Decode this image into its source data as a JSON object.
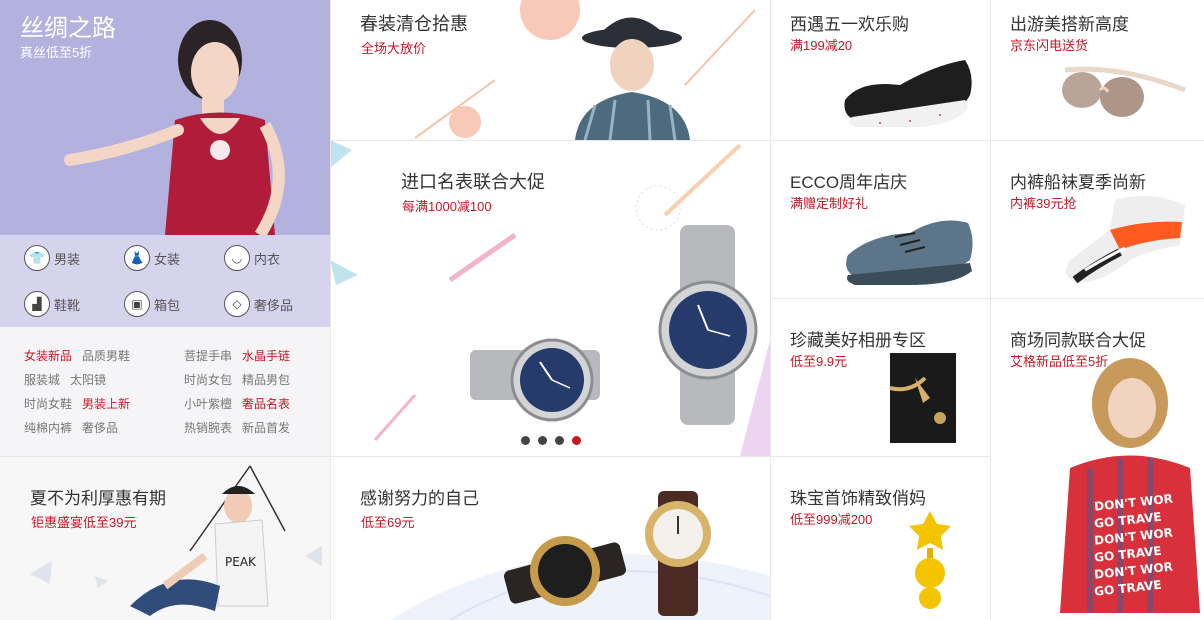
{
  "silk": {
    "title": "丝绸之路",
    "subtitle": "真丝低至5折",
    "categories": [
      {
        "label": "男装",
        "icon": "tshirt-icon",
        "glyph": "👕"
      },
      {
        "label": "女装",
        "icon": "dress-icon",
        "glyph": "👗"
      },
      {
        "label": "内衣",
        "icon": "bra-icon",
        "glyph": "◡"
      },
      {
        "label": "鞋靴",
        "icon": "boot-icon",
        "glyph": "▟"
      },
      {
        "label": "箱包",
        "icon": "bag-icon",
        "glyph": "▣"
      },
      {
        "label": "奢侈品",
        "icon": "diamond-icon",
        "glyph": "◇"
      }
    ],
    "keywords": [
      [
        "女装新品",
        "品质男鞋",
        "菩提手串",
        "水晶手链"
      ],
      [
        "服装城",
        "太阳镜",
        "时尚女包",
        "精品男包"
      ],
      [
        "时尚女鞋",
        "男装上新",
        "小叶紫檀",
        "奢品名表"
      ],
      [
        "纯棉内裤",
        "奢侈品",
        "热销腕表",
        "新品首发"
      ]
    ],
    "red_keywords": [
      "女装新品",
      "水晶手链",
      "男装上新",
      "奢品名表"
    ]
  },
  "tiles": {
    "spring": {
      "title": "春装清仓拾惠",
      "subtitle": "全场大放价"
    },
    "watches": {
      "title": "进口名表联合大促",
      "subtitle": "每满1000减100"
    },
    "summer": {
      "title": "夏不为利厚惠有期",
      "subtitle": "钜惠盛宴低至39元"
    },
    "thanks": {
      "title": "感谢努力的自己",
      "subtitle": "低至69元"
    },
    "wednesday": {
      "title": "西遇五一欢乐购",
      "subtitle": "满199减20"
    },
    "ecco": {
      "title": "ECCO周年店庆",
      "subtitle": "满赠定制好礼"
    },
    "album": {
      "title": "珍藏美好相册专区",
      "subtitle": "低至9.9元"
    },
    "jewelry": {
      "title": "珠宝首饰精致俏妈",
      "subtitle": "低至999减200"
    },
    "travel": {
      "title": "出游美搭新高度",
      "subtitle": "京东闪电送货"
    },
    "socks": {
      "title": "内裤船袜夏季尚新",
      "subtitle": "内裤39元抢"
    },
    "mall": {
      "title": "商场同款联合大促",
      "subtitle": "艾格新品低至5折"
    }
  },
  "tshirt_text": [
    "DON'T WOR",
    "GO TRAVE",
    "DON'T WOR",
    "GO TRAVE",
    "DON'T WOR",
    "GO TRAVE"
  ],
  "slider": {
    "dots": 4,
    "active_index": 3
  },
  "colors": {
    "accent": "#c81623",
    "silk_bg": "#b3b1dd"
  }
}
